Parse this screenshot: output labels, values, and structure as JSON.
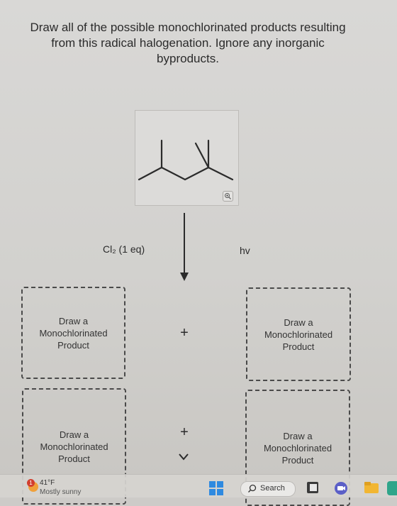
{
  "question": {
    "text": "Draw all of the possible monochlorinated products resulting from this radical halogenation. Ignore any inorganic byproducts."
  },
  "reaction": {
    "reagent": "Cl₂ (1 eq)",
    "condition": "hv",
    "plus": "+"
  },
  "drop_zones": [
    {
      "label": "Draw a\nMonochlorinated\nProduct"
    },
    {
      "label": "Draw a\nMonochlorinated\nProduct"
    },
    {
      "label": "Draw a\nMonochlorinated\nProduct"
    },
    {
      "label": "Draw a\nMonochlorinated\nProduct"
    }
  ],
  "taskbar": {
    "weather_temp": "41°F",
    "weather_condition": "Mostly sunny",
    "notification_count": "1",
    "search_label": "Search"
  },
  "icons": {
    "zoom": "zoom-in-icon",
    "arrow": "reaction-arrow-icon",
    "chevron": "chevron-down-icon",
    "windows": "windows-logo-icon",
    "search": "search-icon"
  },
  "colors": {
    "background": "#d6d5d3",
    "accent_windows": "#2f8ae0",
    "badge": "#d23f2f"
  }
}
